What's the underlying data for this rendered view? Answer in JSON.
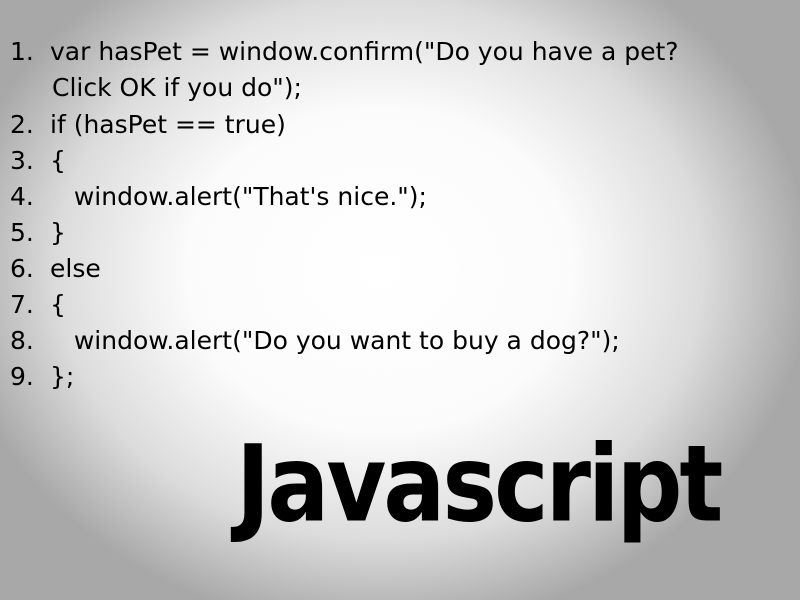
{
  "code": {
    "lines": [
      {
        "num": "1.",
        "text": "var hasPet = window.confirm(\"Do you have a pet?"
      },
      {
        "num": "",
        "text": "Click OK if you do\");"
      },
      {
        "num": "2.",
        "text": "if (hasPet == true)"
      },
      {
        "num": "3.",
        "text": "{"
      },
      {
        "num": "4.",
        "text": "   window.alert(\"That's nice.\");"
      },
      {
        "num": "5.",
        "text": "}"
      },
      {
        "num": "6.",
        "text": "else"
      },
      {
        "num": "7.",
        "text": "{"
      },
      {
        "num": "8.",
        "text": "   window.alert(\"Do you want to buy a dog?\");"
      },
      {
        "num": "9.",
        "text": "};"
      }
    ]
  },
  "title": "Javascript"
}
